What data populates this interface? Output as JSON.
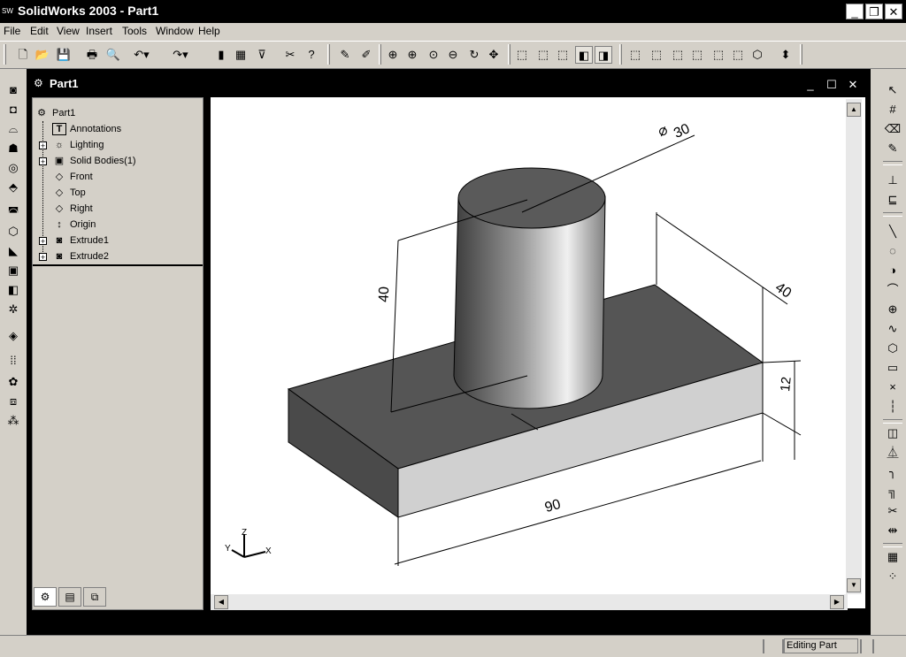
{
  "app": {
    "logo_text": "SW",
    "title": "SolidWorks 2003 - Part1",
    "min_label": "_",
    "restore_label": "❐",
    "close_label": "✕"
  },
  "menu": [
    "File",
    "Edit",
    "View",
    "Insert",
    "Tools",
    "Window",
    "Help"
  ],
  "document": {
    "title": "Part1",
    "min_label": "_",
    "max_label": "☐",
    "close_label": "✕"
  },
  "tree": {
    "root": "Part1",
    "items": [
      "Annotations",
      "Lighting",
      "Solid Bodies(1)",
      "Front",
      "Top",
      "Right",
      "Origin",
      "Extrude1",
      "Extrude2"
    ],
    "expand_symbol": "+"
  },
  "dimensions": {
    "diameter": "30",
    "height": "40",
    "depth": "40",
    "thickness": "12",
    "length": "90"
  },
  "triad": {
    "x": "X",
    "y": "Y",
    "z": "Z"
  },
  "status": {
    "mode": "Editing Part"
  },
  "colors": {
    "titlebar": "#000000",
    "chrome": "#d4d0c8",
    "canvas": "#ffffff",
    "part_dark": "#505050",
    "part_light": "#cfcfcf"
  }
}
